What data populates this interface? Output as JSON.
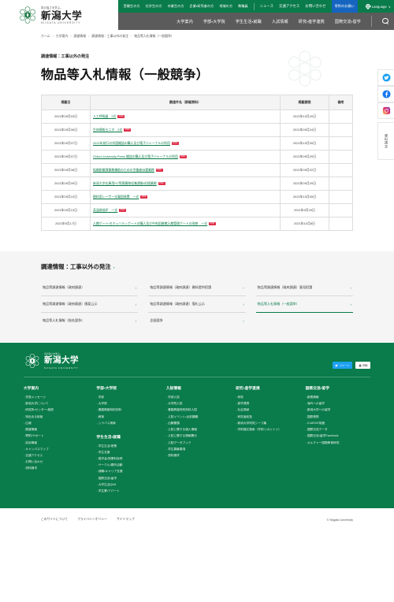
{
  "topbar": {
    "audience_links": [
      {
        "label": "受験生の方"
      },
      {
        "label": "在学生の方"
      },
      {
        "label": "卒業生の方"
      },
      {
        "label": "企業・研究者の方"
      },
      {
        "label": "地域の方"
      },
      {
        "label": "教職員"
      }
    ],
    "utility_links": [
      {
        "label": "ニュース"
      },
      {
        "label": "交通アクセス"
      },
      {
        "label": "お問い合わせ"
      }
    ],
    "donate_label": "寄附のお願い",
    "language_label": "Language",
    "language_caret": "∨"
  },
  "logo": {
    "tagline": "真の強さを学ぶ。",
    "name_jp": "新潟大学",
    "name_en": "NIIGATA UNIVERSITY"
  },
  "mainnav": {
    "items": [
      {
        "label": "大学案内"
      },
      {
        "label": "学部・大学院"
      },
      {
        "label": "学生生活・就職"
      },
      {
        "label": "入試情報"
      },
      {
        "label": "研究・産学連携"
      },
      {
        "label": "国際交流・留学"
      }
    ]
  },
  "breadcrumb": {
    "items": [
      {
        "label": "ホーム"
      },
      {
        "label": "大学案内"
      },
      {
        "label": "調達情報"
      },
      {
        "label": "調達情報：工事以外の発注"
      },
      {
        "label": "物品等入札情報（一般競争）"
      }
    ],
    "separator": "›"
  },
  "page": {
    "eyebrow": "調達情報：工事以外の発注",
    "title": "物品等入札情報（一般競争）"
  },
  "table": {
    "headers": {
      "date": "掲載日",
      "name": "調達件名（詳細資料）",
      "limit": "掲載期限",
      "note": "備考"
    },
    "pdf_badge": "PDF",
    "rows": [
      {
        "date": "2021年09月03日",
        "name": "人工呼吸器　2式",
        "limit": "2021年10月20日",
        "note": ""
      },
      {
        "date": "2021年09月06日",
        "name": "生体情報モニタ　2式",
        "limit": "2021年09月24日",
        "note": ""
      },
      {
        "date": "2021年09月07日",
        "name": "2022年発行の外国雑誌の購入及び電子ジャーナルの利用",
        "limit": "2021年10月05日",
        "note": ""
      },
      {
        "date": "2021年09月07日",
        "name": "Oxford University Press 雑誌の購入及び電子ジャーナルの利用",
        "limit": "2021年09月29日",
        "note": ""
      },
      {
        "date": "2021年09月08日",
        "name": "結婚創業課業務補助のための労働者派遣業務",
        "limit": "2021年09月22日",
        "note": ""
      },
      {
        "date": "2021年09月09日",
        "name": "新潟大学在庫用PC等廃棄物収集運搬・処理業務",
        "limit": "2021年09月29日",
        "note": ""
      },
      {
        "date": "2021年09月10日",
        "name": "眼科用レーザー光凝固装置　一式",
        "limit": "2021年10月05日",
        "note": ""
      },
      {
        "date": "2021年09月13日",
        "name": "高温焼成炉　一式",
        "limit": "2021年9月29日",
        "note": ""
      },
      {
        "date": "2021年9月17日",
        "name": "入館ゲート・セキュリティゲートの購入及び中央図書館入館管理ゲートの改修　一式",
        "limit": "2021年10月8日",
        "note": ""
      }
    ]
  },
  "related": {
    "title": "調達情報：工事以外の発注",
    "arrow": "›",
    "chevron": "›",
    "links": [
      {
        "label": "物品等調達情報（政府調達）",
        "active": false
      },
      {
        "label": "物品等調達情報（政府調達）資料提供招請",
        "active": false
      },
      {
        "label": "物品等調達情報（政府調達）意見招請",
        "active": false
      },
      {
        "label": "物品等調達情報（政府調達）随契公示",
        "active": false
      },
      {
        "label": "物品等調達情報（政府調達）落札公示",
        "active": false
      },
      {
        "label": "物品等入札情報（一般競争）",
        "active": true
      },
      {
        "label": "物品等入札情報（指名競争）",
        "active": false
      },
      {
        "label": "企画競争",
        "active": false
      }
    ]
  },
  "footer": {
    "tweet_label": "ツイート",
    "print_label": "印刷",
    "columns": [
      {
        "head": "大学案内",
        "items": [
          {
            "label": "学長メッセージ"
          },
          {
            "label": "新潟大学について"
          },
          {
            "label": "研究所・センター・施設"
          },
          {
            "label": "特色ある取組"
          },
          {
            "label": "広報"
          },
          {
            "label": "調達情報"
          },
          {
            "label": "寄附・サポート"
          },
          {
            "label": "採用情報"
          },
          {
            "label": "キャンパスマップ"
          },
          {
            "label": "交通アクセス"
          },
          {
            "label": "お問い合わせ"
          },
          {
            "label": "資料請求"
          }
        ]
      },
      {
        "head": "学部・大学院",
        "items": [
          {
            "label": "学部"
          },
          {
            "label": "大学院"
          },
          {
            "label": "養護教諭特別別科"
          },
          {
            "label": "教育"
          },
          {
            "label": "シラバス検索"
          }
        ],
        "head2": "学生生活・就職",
        "items2": [
          {
            "label": "学生生活・授業"
          },
          {
            "label": "学生支援"
          },
          {
            "label": "奨学金・授業料免除"
          },
          {
            "label": "サークル・課外活動"
          },
          {
            "label": "就職・キャリア支援"
          },
          {
            "label": "国際交流・留学"
          },
          {
            "label": "大学生活Q&A"
          },
          {
            "label": "学生寮・アパート"
          }
        ]
      },
      {
        "head": "入試情報",
        "items": [
          {
            "label": "学部入試"
          },
          {
            "label": "大学院入試"
          },
          {
            "label": "養護教諭特別別科入試"
          },
          {
            "label": "入試イベント・出前講義"
          },
          {
            "label": "出願書類"
          },
          {
            "label": "入試に関する個人情報"
          },
          {
            "label": "入試に関する情報開示"
          },
          {
            "label": "入試データブック"
          },
          {
            "label": "学生募集要項"
          },
          {
            "label": "資料請求"
          }
        ]
      },
      {
        "head": "研究・産学連携",
        "items": [
          {
            "label": "研究"
          },
          {
            "label": "産学連携"
          },
          {
            "label": "社会貢献"
          },
          {
            "label": "研究者総覧"
          },
          {
            "label": "新潟大学研究シーズ集"
          },
          {
            "label": "学術論文検索（学術リポジトリ）"
          }
        ]
      },
      {
        "head": "国際交流・留学",
        "items": [
          {
            "label": "新着情報"
          },
          {
            "label": "海外への留学"
          },
          {
            "label": "新潟大学への留学"
          },
          {
            "label": "国際連携"
          },
          {
            "label": "G-MOVE制度"
          },
          {
            "label": "国際交流データ"
          },
          {
            "label": "国際交流・留学Facebook"
          },
          {
            "label": "カルチャー国際教育研究"
          }
        ]
      }
    ]
  },
  "bottombar": {
    "links": [
      {
        "label": "このサイトについて"
      },
      {
        "label": "プライバシーポリシー"
      },
      {
        "label": "サイトマップ"
      }
    ],
    "copyright": "© Niigata University"
  },
  "rail": {
    "doc_label": "資料請求"
  },
  "colors": {
    "brand_green": "#0a7b4a",
    "nav_gray": "#5b5b5b",
    "donate_blue": "#1565c0",
    "pdf_red": "#e0314b"
  }
}
